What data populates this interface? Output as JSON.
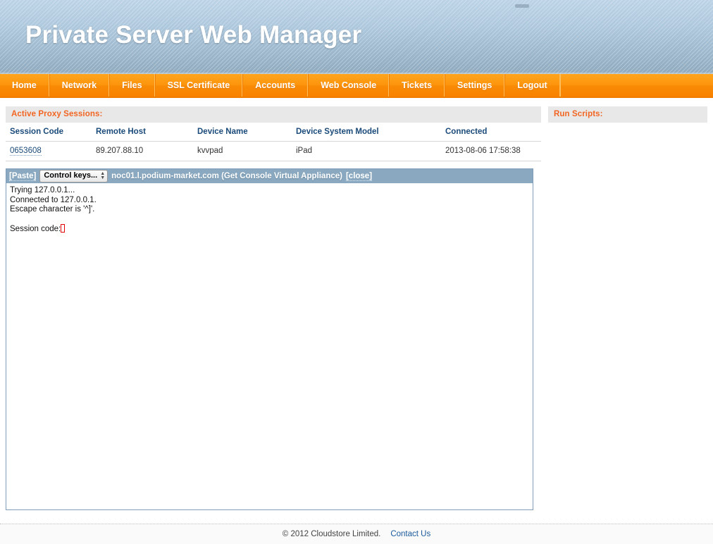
{
  "window": {
    "pill_label": ""
  },
  "header": {
    "title": "Private Server Web Manager"
  },
  "nav": {
    "items": [
      {
        "label": "Home"
      },
      {
        "label": "Network"
      },
      {
        "label": "Files"
      },
      {
        "label": "SSL Certificate"
      },
      {
        "label": "Accounts"
      },
      {
        "label": "Web Console"
      },
      {
        "label": "Tickets"
      },
      {
        "label": "Settings"
      },
      {
        "label": "Logout"
      }
    ]
  },
  "sessions_panel": {
    "heading": "Active Proxy Sessions:",
    "columns": [
      "Session Code",
      "Remote Host",
      "Device Name",
      "Device System Model",
      "Connected"
    ],
    "rows": [
      {
        "session_code": "0653608",
        "remote_host": "89.207.88.10",
        "device_name": "kvvpad",
        "device_system_model": "iPad",
        "connected": "2013-08-06 17:58:38"
      }
    ]
  },
  "run_scripts_panel": {
    "heading": "Run Scripts:"
  },
  "terminal": {
    "paste_label": "[Paste]",
    "control_keys_label": "Control keys...",
    "host_label": "noc01.l.podium-market.com (Get Console Virtual Appliance)",
    "close_label": "[close]",
    "lines": [
      "Trying 127.0.0.1...",
      "Connected to 127.0.0.1.",
      "Escape character is '^]'.",
      "",
      "Session code:"
    ]
  },
  "footer": {
    "copyright": "© 2012 Cloudstore Limited.",
    "contact_label": "Contact Us"
  },
  "colors": {
    "accent_orange": "#f26522",
    "nav_orange": "#f98b05",
    "header_blue": "#aec8dd",
    "link_blue": "#1a4a7a",
    "terminal_bar": "#8aa9c1",
    "cursor_red": "#e00000"
  }
}
